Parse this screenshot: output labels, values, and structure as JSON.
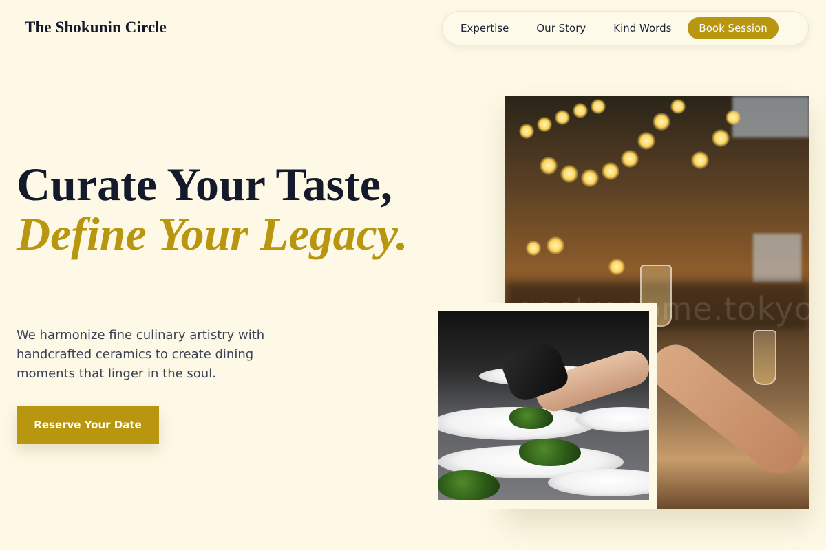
{
  "header": {
    "logo_text": "The Shokunin Circle",
    "nav": [
      {
        "label": "Expertise"
      },
      {
        "label": "Our Story"
      },
      {
        "label": "Kind Words"
      }
    ],
    "cta_label": "Book Session"
  },
  "hero": {
    "title_line1": "Curate Your Taste,",
    "title_accent": "Define Your Legacy.",
    "subtitle": "We harmonize fine culinary artistry with handcrafted ceramics to create dining moments that linger in the soul.",
    "cta_label": "Reserve Your Date"
  },
  "images": {
    "main_watermark": "gastronome.tokyo"
  },
  "colors": {
    "background": "#fdf9e6",
    "accent": "#b8960f",
    "heading": "#141a2b",
    "body_text": "#3a4356"
  }
}
